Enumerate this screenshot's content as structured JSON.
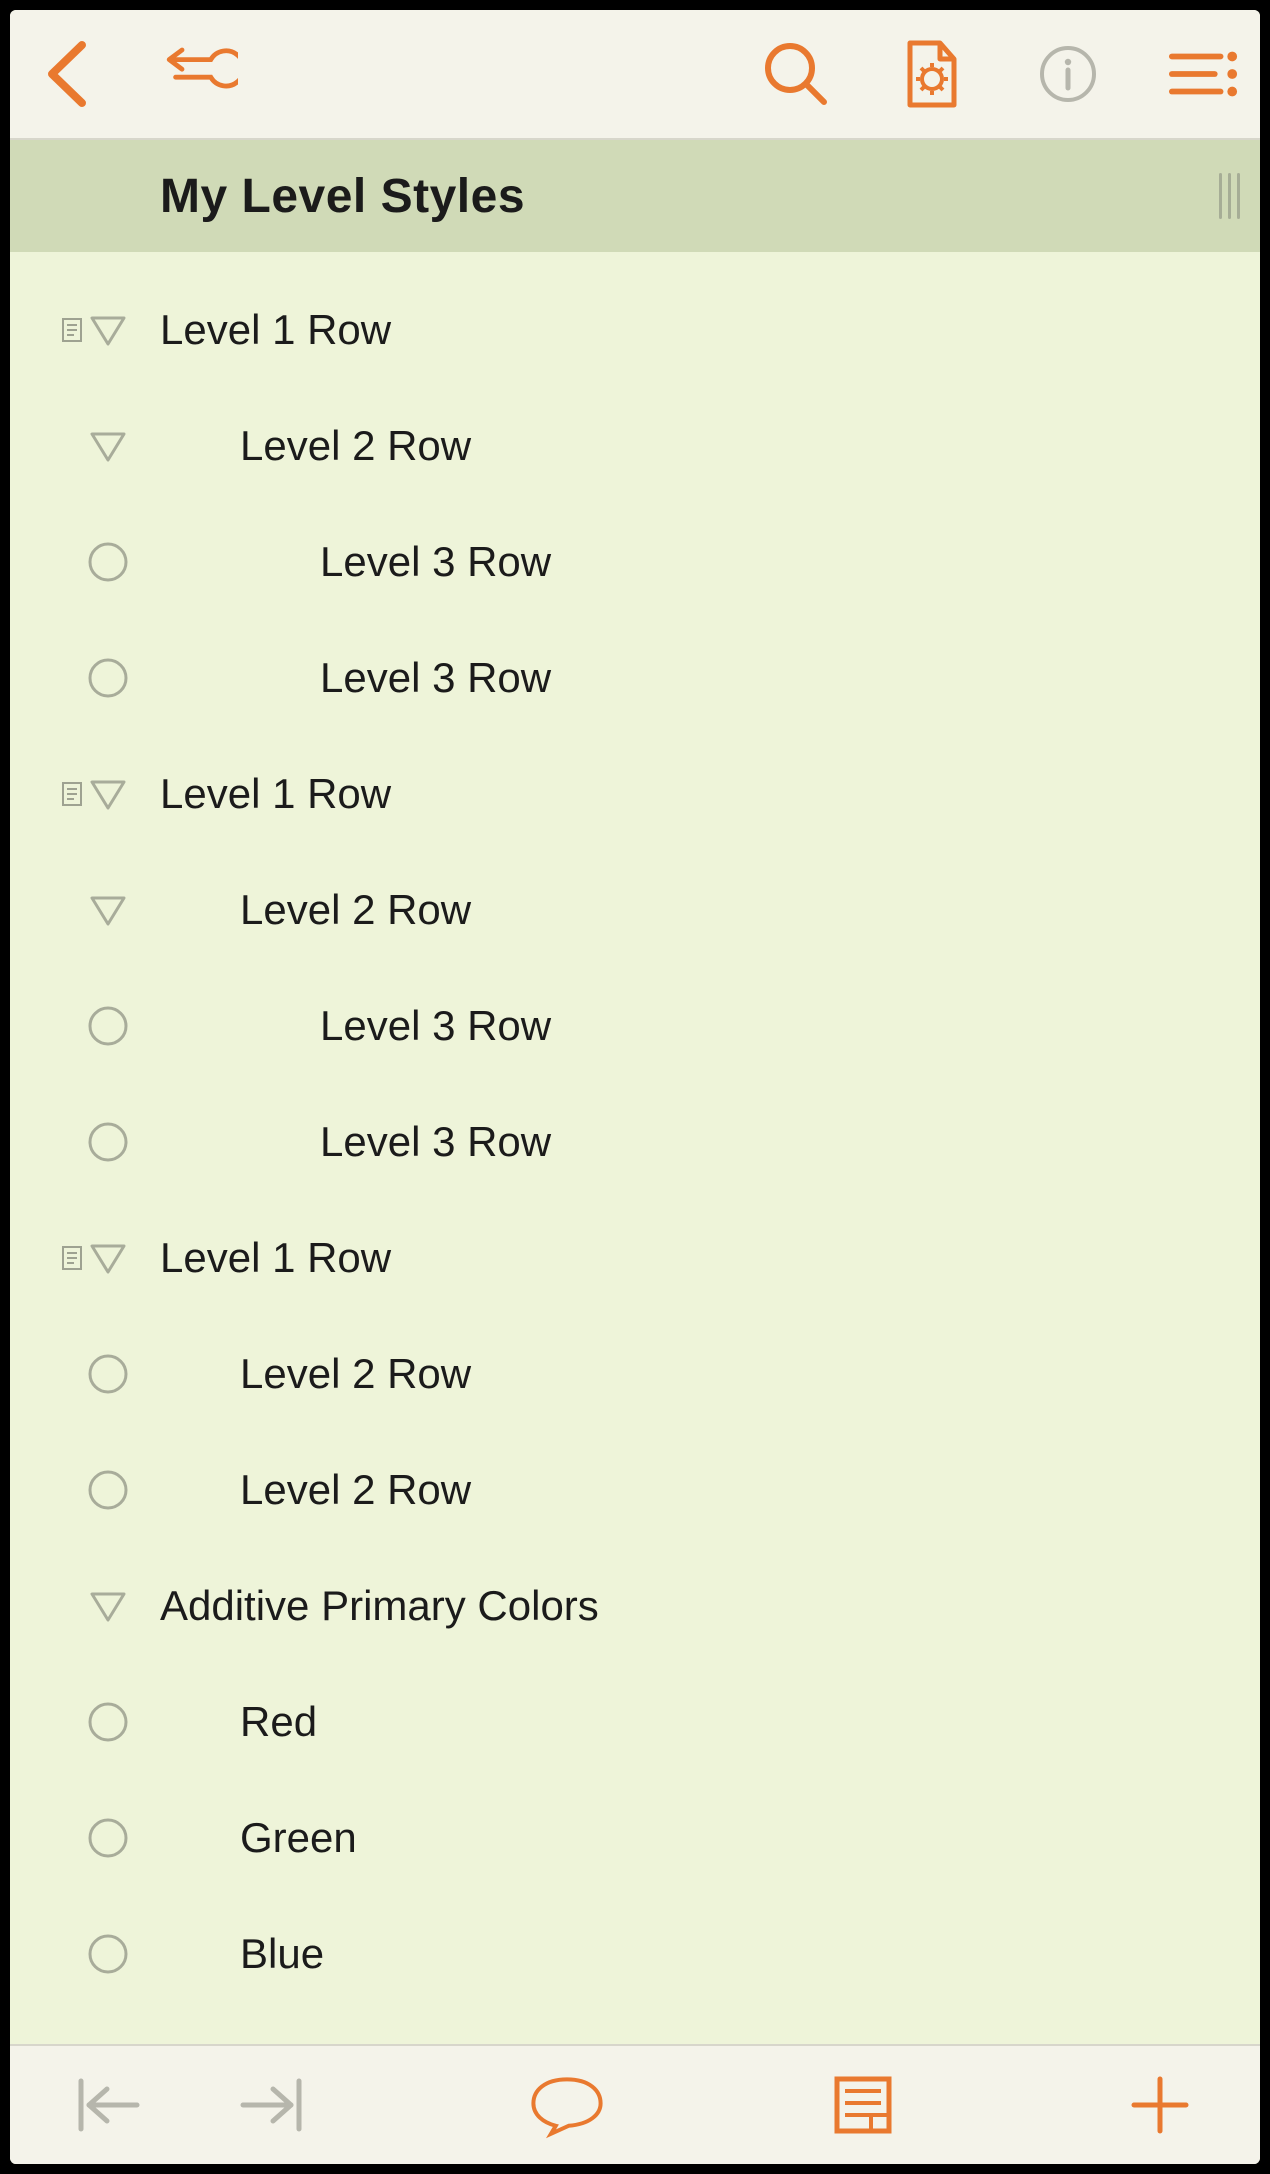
{
  "document": {
    "title": "My Level Styles"
  },
  "toolbar": {
    "back": "Back",
    "undo": "Undo",
    "search": "Search",
    "document_settings": "Document Settings",
    "info": "Info",
    "view_options": "View Options"
  },
  "bottombar": {
    "outdent": "Outdent",
    "indent": "Indent",
    "note": "Note",
    "attachments": "Attachments",
    "add": "Add Row"
  },
  "rows": [
    {
      "label": "Level 1 Row",
      "indent": 0,
      "glyph": "triangle",
      "has_note": true
    },
    {
      "label": "Level 2 Row",
      "indent": 1,
      "glyph": "triangle",
      "has_note": false
    },
    {
      "label": "Level 3 Row",
      "indent": 2,
      "glyph": "circle",
      "has_note": false
    },
    {
      "label": "Level 3 Row",
      "indent": 2,
      "glyph": "circle",
      "has_note": false
    },
    {
      "label": "Level 1 Row",
      "indent": 0,
      "glyph": "triangle",
      "has_note": true
    },
    {
      "label": "Level 2 Row",
      "indent": 1,
      "glyph": "triangle",
      "has_note": false
    },
    {
      "label": "Level 3 Row",
      "indent": 2,
      "glyph": "circle",
      "has_note": false
    },
    {
      "label": "Level 3 Row",
      "indent": 2,
      "glyph": "circle",
      "has_note": false
    },
    {
      "label": "Level 1 Row",
      "indent": 0,
      "glyph": "triangle",
      "has_note": true
    },
    {
      "label": "Level 2 Row",
      "indent": 1,
      "glyph": "circle",
      "has_note": false
    },
    {
      "label": "Level 2 Row",
      "indent": 1,
      "glyph": "circle",
      "has_note": false
    },
    {
      "label": "Additive Primary Colors",
      "indent": 0,
      "glyph": "triangle",
      "has_note": false
    },
    {
      "label": "Red",
      "indent": 1,
      "glyph": "circle",
      "has_note": false
    },
    {
      "label": "Green",
      "indent": 1,
      "glyph": "circle",
      "has_note": false
    },
    {
      "label": "Blue",
      "indent": 1,
      "glyph": "circle",
      "has_note": false
    }
  ]
}
